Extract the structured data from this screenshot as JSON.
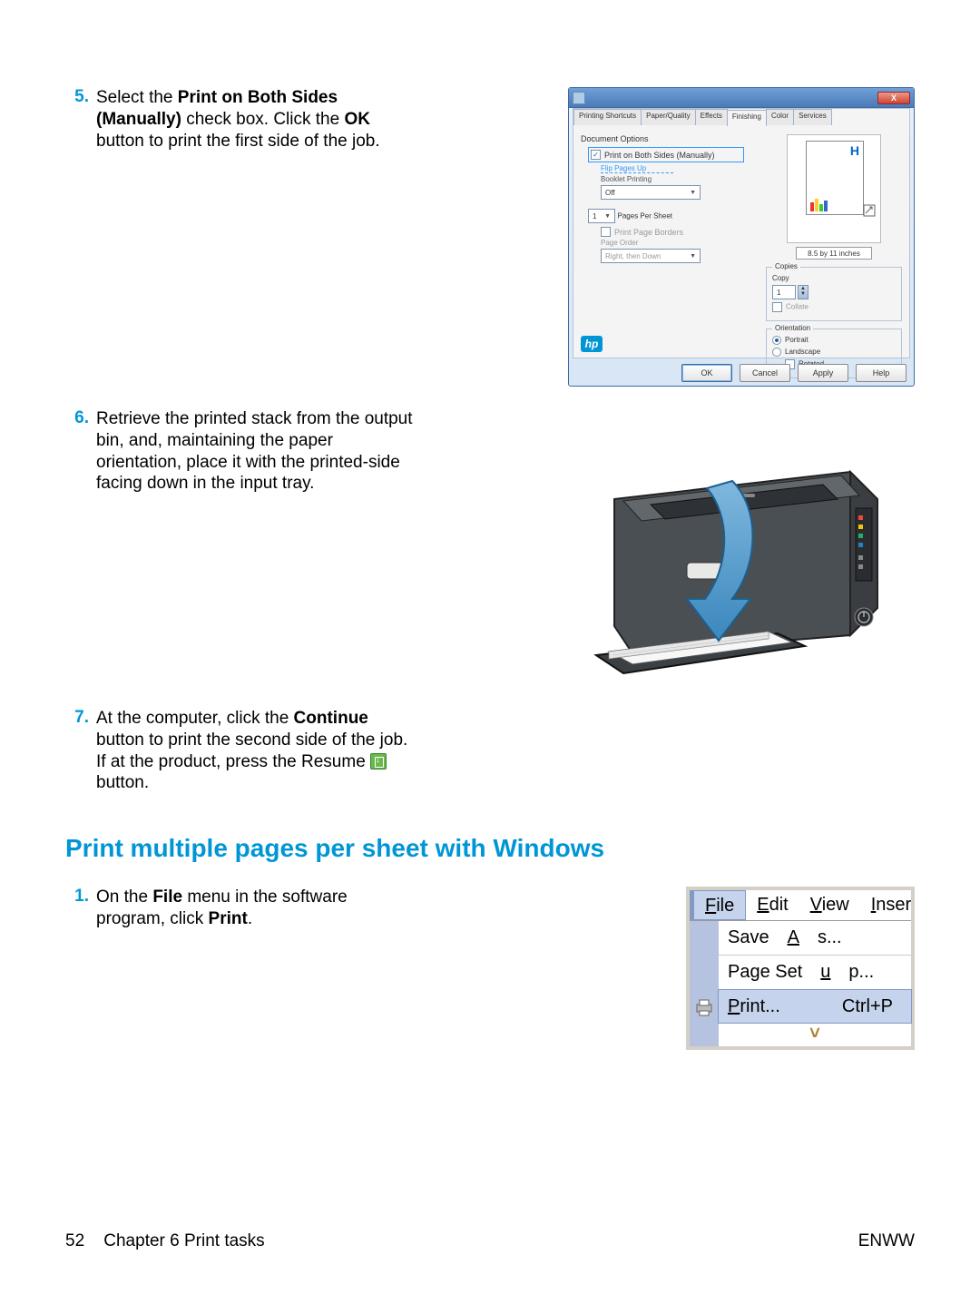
{
  "steps": {
    "s5": {
      "num": "5.",
      "pre": "Select the ",
      "b1": "Print on Both Sides (Manually)",
      "mid1": " check box. Click the ",
      "b2": "OK",
      "post": " button to print the first side of the job."
    },
    "s6": {
      "num": "6.",
      "text": "Retrieve the printed stack from the output bin, and, maintaining the paper orientation, place it with the printed-side facing down in the input tray."
    },
    "s7": {
      "num": "7.",
      "pre": "At the computer, click the ",
      "b1": "Continue",
      "mid1": " button to print the second side of the job. If at the product, press the Resume ",
      "post": " button."
    },
    "s1b": {
      "num": "1.",
      "pre": "On the ",
      "b1": "File",
      "mid1": " menu in the software program, click ",
      "b2": "Print",
      "post": "."
    }
  },
  "heading": "Print multiple pages per sheet with Windows",
  "dialog": {
    "tabs": [
      "Printing Shortcuts",
      "Paper/Quality",
      "Effects",
      "Finishing",
      "Color",
      "Services"
    ],
    "doc_options": "Document Options",
    "print_both": "Print on Both Sides (Manually)",
    "flip": "Flip Pages Up",
    "booklet": "Booklet Printing",
    "booklet_val": "Off",
    "pps_val": "1",
    "pps_label": "Pages Per Sheet",
    "ppb": "Print Page Borders",
    "page_order": "Page Order",
    "page_order_val": "Right, then Down",
    "preview_size": "8.5 by 11 inches",
    "copies": "Copies",
    "copy": "Copy",
    "copy_val": "1",
    "collate": "Collate",
    "orientation": "Orientation",
    "portrait": "Portrait",
    "landscape": "Landscape",
    "rotated": "Rotated",
    "ok": "OK",
    "cancel": "Cancel",
    "apply": "Apply",
    "help": "Help",
    "close_x": "X"
  },
  "filemenu": {
    "menubar": {
      "file": "File",
      "edit": "Edit",
      "view": "View",
      "insert": "Inser"
    },
    "items": {
      "save_as": "Save As...",
      "page_setup": "Page Setup...",
      "print": "Print...",
      "print_shortcut": "Ctrl+P"
    },
    "expand": "˅"
  },
  "footer": {
    "page": "52",
    "chapter": "Chapter 6   Print tasks",
    "brand": "ENWW"
  }
}
